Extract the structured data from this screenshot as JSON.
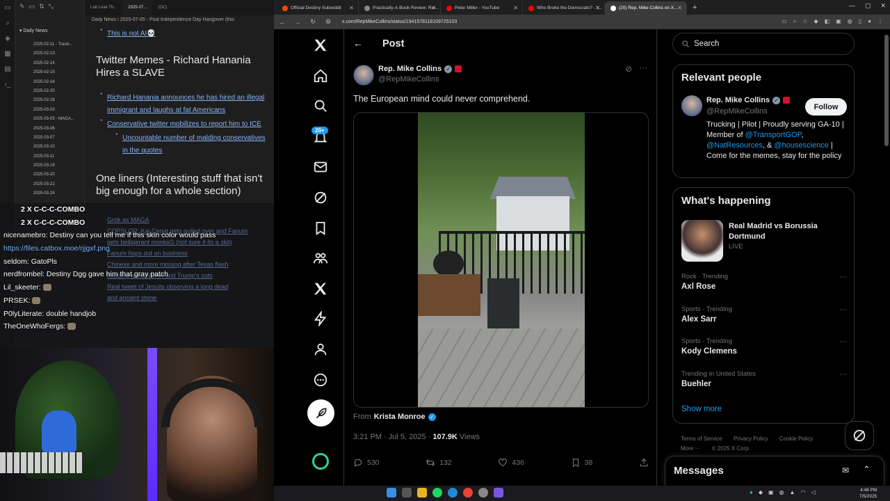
{
  "obsidian": {
    "tabs": [
      "Lab Leak Th...",
      "2025-07...",
      "(OC)"
    ],
    "tree_folder": "Daily News",
    "tree_files": [
      "2025-02-11 - Tracki...",
      "2025-02-13",
      "2025-02-14",
      "2025-02-15",
      "2025-02-16",
      "2025-02-25",
      "2025-02-28",
      "2025-03-03",
      "2025-03-05 - MAGA...",
      "2025-03-06",
      "2025-03-07",
      "2025-03-10",
      "2025-03-11",
      "2025-03-19",
      "2025-03-20",
      "2025-03-21",
      "2025-03-24"
    ],
    "breadcrumb": "Daily News / 2025-07-05 - Post Independence Day Hangover (this",
    "top_link": "This is not AI💀",
    "section1_title": "Twitter Memes - Richard Hanania Hires a SLAVE",
    "section1_items": [
      "Richard Hanania announces he has hired an illegal immigrant and laughs at fat Americans",
      "Conservative twitter mobilizes to report him to ICE"
    ],
    "section1_sub": "Uncountable number of malding conservatives in the quotes",
    "section2_title": "One liners (Interesting stuff that isn't big enough for a whole section)",
    "bg_notes": [
      "Grok as MAGA",
      "COPSLOP: Kai Cenat gets pulled over and Fanum",
      "gets belligerant monkaS (not sure if its a skit)",
      "Fanum hops out on business",
      "Chinese and more missing after Texas flash",
      "flooding amid NOAA and Trump's cuts",
      "Real tweet of Jesuits observing a long dead",
      "and ancient stone"
    ]
  },
  "chat": {
    "combo1": "2 X C-C-C-COMBO",
    "combo2": "2 X C-C-C-COMBO",
    "lines": [
      {
        "user": "nicenamebro:",
        "text": "Destiny can you tell me if this skin color would pass"
      },
      {
        "user": "",
        "text": "https://files.catbox.moe/rjjgxf.png",
        "link": true
      },
      {
        "user": "seldom:",
        "text": "GatoPls"
      },
      {
        "user": "nerdfrombel:",
        "text": "Destiny Dgg gave him that gray patch"
      },
      {
        "user": "Lil_skeeter:",
        "text": ""
      },
      {
        "user": "PRSEK:",
        "text": ""
      },
      {
        "user": "P0lyLiterate:",
        "text": "double handjob"
      },
      {
        "user": "TheOneWhoFergs:",
        "text": ""
      }
    ]
  },
  "browser": {
    "tabs": [
      {
        "title": "Official Destiny Subreddit",
        "color": "#ff4500",
        "active": false
      },
      {
        "title": "Practically-A-Book Review: Rot...",
        "color": "#888888",
        "active": false
      },
      {
        "title": "Peter Miller - YouTube",
        "color": "#ff0000",
        "active": false
      },
      {
        "title": "Who Broke the Democrats? - Y...",
        "color": "#ff0000",
        "active": false
      },
      {
        "title": "(20) Rep. Mike Collins on X...",
        "color": "#ffffff",
        "active": true
      }
    ],
    "url": "x.com/RepMikeCollins/status/1941578118109725103"
  },
  "xnav": {
    "badge": "20+"
  },
  "post": {
    "heading": "Post",
    "author_name": "Rep. Mike Collins",
    "author_handle": "@RepMikeCollins",
    "text": "The European mind could never comprehend.",
    "from_label": "From",
    "from_name": "Krista Monroe",
    "time": "3:21 PM · Jul 5, 2025 ·",
    "views_count": "107.9K",
    "views_label": "Views",
    "replies": "530",
    "reposts": "132",
    "likes": "436",
    "bookmarks": "38"
  },
  "sidebar": {
    "search_placeholder": "Search",
    "relevant_title": "Relevant people",
    "rel_name": "Rep. Mike Collins",
    "rel_handle": "@RepMikeCollins",
    "follow": "Follow",
    "bio_1": "Trucking | Pilot | Proudly serving GA-10 | Member of",
    "bio_m1": "@TransportGOP",
    "bio_2": ",",
    "bio_m2": "@NatResources",
    "bio_3": ", &",
    "bio_m3": "@housescience",
    "bio_4": "| Come for the memes, stay for the policy",
    "happening_title": "What's happening",
    "event_title": "Real Madrid vs Borussia Dortmund",
    "event_status": "LIVE",
    "trends": [
      {
        "cat": "Rock · Trending",
        "name": "Axl Rose"
      },
      {
        "cat": "Sports · Trending",
        "name": "Alex Sarr"
      },
      {
        "cat": "Sports · Trending",
        "name": "Kody Clemens"
      },
      {
        "cat": "Trending in United States",
        "name": "Buehler"
      }
    ],
    "show_more": "Show more",
    "footer": [
      "Terms of Service",
      "Privacy Policy",
      "Cookie Policy",
      "More ···",
      "© 2025 X Corp."
    ],
    "messages": "Messages"
  },
  "taskbar": {
    "time": "4:48 PM",
    "date": "7/5/2025"
  }
}
